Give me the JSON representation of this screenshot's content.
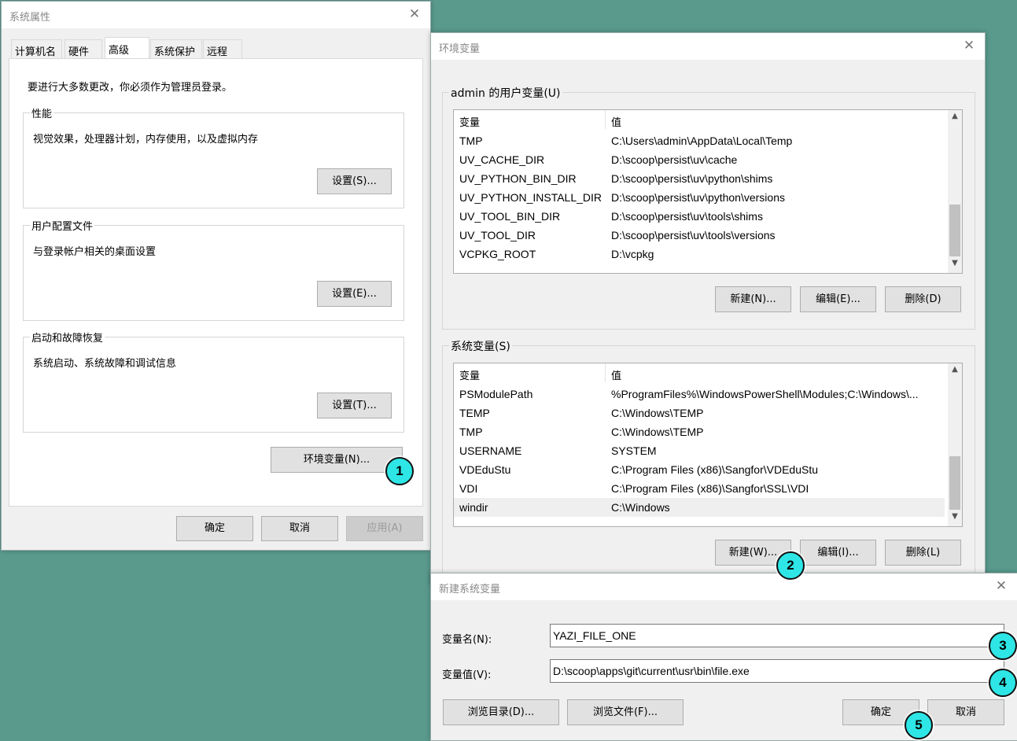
{
  "sys_props": {
    "title": "系统属性",
    "tabs": [
      "计算机名",
      "硬件",
      "高级",
      "系统保护",
      "远程"
    ],
    "admin_note": "要进行大多数更改，你必须作为管理员登录。",
    "groups": [
      {
        "label": "性能",
        "desc": "视觉效果，处理器计划，内存使用，以及虚拟内存",
        "button": "设置(S)..."
      },
      {
        "label": "用户配置文件",
        "desc": "与登录帐户相关的桌面设置",
        "button": "设置(E)..."
      },
      {
        "label": "启动和故障恢复",
        "desc": "系统启动、系统故障和调试信息",
        "button": "设置(T)..."
      }
    ],
    "env_button": "环境变量(N)...",
    "ok": "确定",
    "cancel": "取消",
    "apply": "应用(A)"
  },
  "env_vars": {
    "title": "环境变量",
    "user_group_label": "admin 的用户变量(U)",
    "col_var": "变量",
    "col_val": "值",
    "user_rows": [
      {
        "name": "TMP",
        "value": "C:\\Users\\admin\\AppData\\Local\\Temp"
      },
      {
        "name": "UV_CACHE_DIR",
        "value": "D:\\scoop\\persist\\uv\\cache"
      },
      {
        "name": "UV_PYTHON_BIN_DIR",
        "value": "D:\\scoop\\persist\\uv\\python\\shims"
      },
      {
        "name": "UV_PYTHON_INSTALL_DIR",
        "value": "D:\\scoop\\persist\\uv\\python\\versions"
      },
      {
        "name": "UV_TOOL_BIN_DIR",
        "value": "D:\\scoop\\persist\\uv\\tools\\shims"
      },
      {
        "name": "UV_TOOL_DIR",
        "value": "D:\\scoop\\persist\\uv\\tools\\versions"
      },
      {
        "name": "VCPKG_ROOT",
        "value": "D:\\vcpkg"
      }
    ],
    "user_buttons": {
      "new": "新建(N)...",
      "edit": "编辑(E)...",
      "delete": "删除(D)"
    },
    "system_group_label": "系统变量(S)",
    "system_rows": [
      {
        "name": "PSModulePath",
        "value": "%ProgramFiles%\\WindowsPowerShell\\Modules;C:\\Windows\\..."
      },
      {
        "name": "TEMP",
        "value": "C:\\Windows\\TEMP"
      },
      {
        "name": "TMP",
        "value": "C:\\Windows\\TEMP"
      },
      {
        "name": "USERNAME",
        "value": "SYSTEM"
      },
      {
        "name": "VDEduStu",
        "value": "C:\\Program Files (x86)\\Sangfor\\VDEduStu"
      },
      {
        "name": "VDI",
        "value": "C:\\Program Files (x86)\\Sangfor\\SSL\\VDI"
      },
      {
        "name": "windir",
        "value": "C:\\Windows"
      }
    ],
    "system_buttons": {
      "new": "新建(W)...",
      "edit": "编辑(I)...",
      "delete": "删除(L)"
    }
  },
  "new_var": {
    "title": "新建系统变量",
    "name_label": "变量名(N):",
    "name_value": "YAZI_FILE_ONE",
    "value_label": "变量值(V):",
    "value_value": "D:\\scoop\\apps\\git\\current\\usr\\bin\\file.exe",
    "browse_dir": "浏览目录(D)...",
    "browse_file": "浏览文件(F)...",
    "ok": "确定",
    "cancel": "取消"
  },
  "badges": [
    "1",
    "2",
    "3",
    "4",
    "5"
  ],
  "close_glyph": "✕",
  "colors": {
    "background": "#5a9a8d",
    "badge": "#2ee6e6"
  }
}
